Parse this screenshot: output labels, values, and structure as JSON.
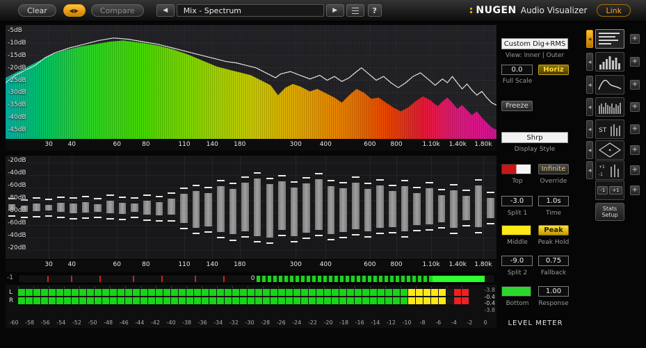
{
  "toolbar": {
    "clear": "Clear",
    "compare": "Compare",
    "preset": "Mix - Spectrum",
    "help": "?",
    "link": "Link",
    "brand": "NUGEN",
    "brand_suffix": "Audio Visualizer"
  },
  "icons": {
    "swap": "◀▶",
    "prev": "◀",
    "play": "▶",
    "plus": "+",
    "arrow": "◀"
  },
  "freq_axis": {
    "ticks": [
      [
        "30",
        8.8
      ],
      [
        "40",
        13.5
      ],
      [
        "60",
        22.7
      ],
      [
        "80",
        28.6
      ],
      [
        "110",
        36.4
      ],
      [
        "140",
        42.1
      ],
      [
        "180",
        47.7
      ],
      [
        "300",
        59.1
      ],
      [
        "400",
        65.2
      ],
      [
        "600",
        74.2
      ],
      [
        "800",
        79.6
      ],
      [
        "1.10k",
        86.7
      ],
      [
        "1.40k",
        92.1
      ],
      [
        "1.80k",
        97.3
      ]
    ]
  },
  "spectrum_panel": {
    "db_labels": [
      "-5dB",
      "-10dB",
      "-15dB",
      "-20dB",
      "-25dB",
      "-30dB",
      "-35dB",
      "-40dB",
      "-45dB"
    ]
  },
  "histogram_panel": {
    "db_labels": [
      "-20dB",
      "-40dB",
      "-60dB",
      "-80dB",
      "-80dB",
      "-60dB",
      "-40dB",
      "-20dB"
    ]
  },
  "correlation": {
    "min": "-1",
    "zero": "0"
  },
  "meter": {
    "channels": [
      "L",
      "R"
    ],
    "readouts": [
      "-3.8",
      "-0.4",
      "-0.4",
      "-3.8"
    ],
    "scale": [
      "-60",
      "-58",
      "-56",
      "-54",
      "-52",
      "-50",
      "-48",
      "-46",
      "-44",
      "-42",
      "-40",
      "-38",
      "-36",
      "-34",
      "-32",
      "-30",
      "-28",
      "-26",
      "-24",
      "-22",
      "-20",
      "-18",
      "-16",
      "-14",
      "-12",
      "-10",
      "-8",
      "-6",
      "-4",
      "-2",
      "0"
    ]
  },
  "controls": {
    "mode": "Custom Dig+RMS",
    "view": "View: Inner | Outer",
    "full_scale_value": "0.0",
    "horiz": "Horiz",
    "full_scale": "Full Scale",
    "freeze": "Freeze",
    "display_style_value": "Shrp",
    "display_style": "Display Style",
    "infinite": "Infinite",
    "top": "Top",
    "override": "Override",
    "split1_value": "-3.0",
    "time_value": "1.0s",
    "split1": "Split 1",
    "time": "Time",
    "peak": "Peak",
    "middle": "Middle",
    "peak_hold": "Peak Hold",
    "split2_value": "-9.0",
    "fallback_value": "0.75",
    "split2": "Split 2",
    "fallback": "Fallback",
    "response_value": "1.00",
    "bottom": "Bottom",
    "response": "Response",
    "level_meter": "LEVEL METER"
  },
  "sidebar": {
    "st": "ST",
    "minus": "-1",
    "plus": "+1",
    "stats_line1": "Stats",
    "stats_line2": "Setup"
  },
  "colors": {
    "accent_orange": "#ff9a00",
    "meter_green": "#17d517",
    "meter_yellow": "#ffe818",
    "meter_red": "#ee2020"
  },
  "chart_data": [
    {
      "type": "area",
      "name": "spectrum-average",
      "x_unit": "percent",
      "y_unit": "dB",
      "ylim": [
        -52,
        -5
      ],
      "points": [
        [
          0,
          -24
        ],
        [
          2,
          -22
        ],
        [
          4,
          -20
        ],
        [
          6,
          -18
        ],
        [
          9,
          -15
        ],
        [
          12,
          -13
        ],
        [
          15,
          -11.5
        ],
        [
          18,
          -10.5
        ],
        [
          21,
          -9.5
        ],
        [
          24,
          -9
        ],
        [
          26,
          -9.5
        ],
        [
          28,
          -10
        ],
        [
          31,
          -11
        ],
        [
          34,
          -12.5
        ],
        [
          37,
          -14.5
        ],
        [
          40,
          -17
        ],
        [
          43,
          -19.5
        ],
        [
          46,
          -21
        ],
        [
          48,
          -22
        ],
        [
          50,
          -23
        ],
        [
          52,
          -25
        ],
        [
          54,
          -27
        ],
        [
          55.5,
          -31
        ],
        [
          57,
          -28
        ],
        [
          58.5,
          -26.5
        ],
        [
          60,
          -27.5
        ],
        [
          62,
          -29.5
        ],
        [
          63.5,
          -28.5
        ],
        [
          65,
          -30
        ],
        [
          67,
          -32
        ],
        [
          68.5,
          -34
        ],
        [
          70,
          -31
        ],
        [
          71.5,
          -28.5
        ],
        [
          73,
          -30
        ],
        [
          74.5,
          -32.5
        ],
        [
          76,
          -32
        ],
        [
          77.5,
          -34
        ],
        [
          79,
          -36
        ],
        [
          80.5,
          -37.5
        ],
        [
          82,
          -36
        ],
        [
          83.5,
          -33.5
        ],
        [
          85,
          -31.5
        ],
        [
          86.5,
          -33
        ],
        [
          88,
          -35.5
        ],
        [
          89,
          -33.5
        ],
        [
          90,
          -32
        ],
        [
          91,
          -34
        ],
        [
          92,
          -36.5
        ],
        [
          93,
          -35
        ],
        [
          94,
          -37
        ],
        [
          95,
          -39
        ],
        [
          96,
          -37.5
        ],
        [
          97,
          -40
        ],
        [
          98,
          -42
        ],
        [
          99,
          -44
        ],
        [
          100,
          -45
        ]
      ]
    },
    {
      "type": "line",
      "name": "spectrum-peak-hold",
      "x_unit": "percent",
      "y_unit": "dB",
      "points": [
        [
          0,
          -26
        ],
        [
          2,
          -23
        ],
        [
          4,
          -21
        ],
        [
          6,
          -19
        ],
        [
          8,
          -16
        ],
        [
          10,
          -14
        ],
        [
          13,
          -12
        ],
        [
          16,
          -10.5
        ],
        [
          19,
          -9
        ],
        [
          22,
          -8
        ],
        [
          25,
          -8.5
        ],
        [
          28,
          -9.5
        ],
        [
          31,
          -10.5
        ],
        [
          34,
          -12
        ],
        [
          37,
          -13.5
        ],
        [
          40,
          -15
        ],
        [
          43,
          -16.5
        ],
        [
          45,
          -17.5
        ],
        [
          47,
          -18
        ],
        [
          49,
          -19
        ],
        [
          51,
          -20
        ],
        [
          53,
          -22
        ],
        [
          55,
          -24
        ],
        [
          56,
          -22.5
        ],
        [
          58,
          -21.5
        ],
        [
          60,
          -23
        ],
        [
          62,
          -24.5
        ],
        [
          64,
          -23
        ],
        [
          65.5,
          -25
        ],
        [
          67,
          -23.5
        ],
        [
          68.5,
          -25.5
        ],
        [
          70,
          -24
        ],
        [
          71.5,
          -21.5
        ],
        [
          72.5,
          -20
        ],
        [
          74,
          -22.5
        ],
        [
          75.5,
          -25
        ],
        [
          77,
          -23.5
        ],
        [
          78.5,
          -26
        ],
        [
          80,
          -28
        ],
        [
          81.5,
          -26
        ],
        [
          83,
          -23.5
        ],
        [
          84.5,
          -22
        ],
        [
          86,
          -24.5
        ],
        [
          87.5,
          -27
        ],
        [
          89,
          -24.5
        ],
        [
          90,
          -26
        ],
        [
          91,
          -23.5
        ],
        [
          92,
          -26
        ],
        [
          93,
          -28.5
        ],
        [
          94,
          -26.5
        ],
        [
          95,
          -29
        ],
        [
          96,
          -31
        ],
        [
          97,
          -29.5
        ],
        [
          98,
          -32
        ],
        [
          99,
          -34
        ],
        [
          100,
          -35
        ]
      ]
    },
    {
      "type": "bar",
      "name": "histogram-range-bars",
      "unit": "fraction-of-half-height",
      "bars": [
        [
          0.07,
          0.06
        ],
        [
          0.05,
          0.08
        ],
        [
          0.09,
          0.07
        ],
        [
          0.06,
          0.06
        ],
        [
          0.1,
          0.09
        ],
        [
          0.08,
          0.11
        ],
        [
          0.12,
          0.1
        ],
        [
          0.07,
          0.08
        ],
        [
          0.14,
          0.12
        ],
        [
          0.1,
          0.13
        ],
        [
          0.08,
          0.09
        ],
        [
          0.15,
          0.14
        ],
        [
          0.12,
          0.16
        ],
        [
          0.18,
          0.15
        ],
        [
          0.28,
          0.32
        ],
        [
          0.35,
          0.42
        ],
        [
          0.3,
          0.38
        ],
        [
          0.45,
          0.5
        ],
        [
          0.38,
          0.55
        ],
        [
          0.52,
          0.48
        ],
        [
          0.6,
          0.58
        ],
        [
          0.48,
          0.62
        ],
        [
          0.55,
          0.45
        ],
        [
          0.42,
          0.58
        ],
        [
          0.5,
          0.52
        ],
        [
          0.58,
          0.46
        ],
        [
          0.44,
          0.54
        ],
        [
          0.4,
          0.5
        ],
        [
          0.52,
          0.44
        ],
        [
          0.38,
          0.48
        ],
        [
          0.46,
          0.42
        ],
        [
          0.34,
          0.4
        ],
        [
          0.44,
          0.48
        ],
        [
          0.3,
          0.36
        ],
        [
          0.4,
          0.34
        ],
        [
          0.26,
          0.3
        ],
        [
          0.36,
          0.42
        ],
        [
          0.24,
          0.26
        ],
        [
          0.46,
          0.4
        ],
        [
          0.2,
          0.22
        ]
      ]
    },
    {
      "type": "meter",
      "name": "level-meter",
      "blocks": 59,
      "zones": {
        "green": [
          0,
          50
        ],
        "yellow": [
          51,
          55
        ],
        "red": [
          57,
          58
        ]
      }
    },
    {
      "type": "meter",
      "name": "correlation-meter",
      "range": [
        "-1",
        "+1"
      ],
      "red_ticks_pct": [
        6,
        11,
        17,
        24,
        30,
        37,
        43
      ],
      "green_dash_span_pct": [
        50,
        98
      ],
      "solid_span_pct": [
        87,
        98
      ]
    }
  ]
}
